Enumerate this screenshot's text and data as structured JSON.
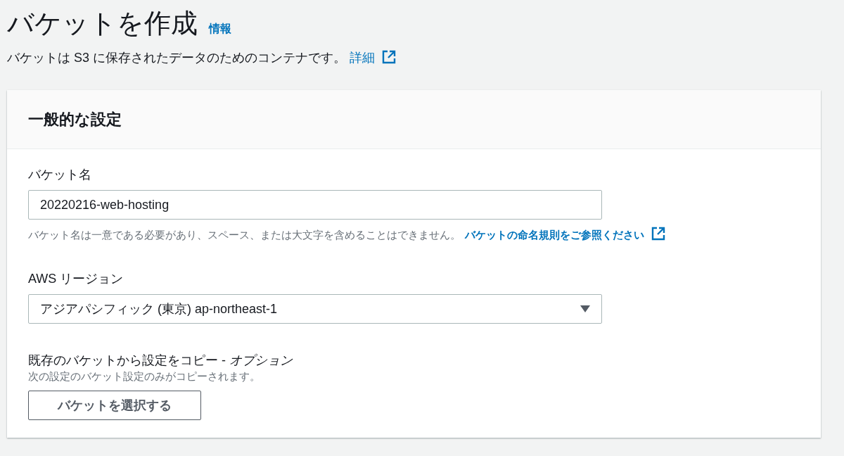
{
  "header": {
    "title": "バケットを作成",
    "info_link": "情報",
    "description": "バケットは S3 に保存されたデータのためのコンテナです。",
    "details_link": "詳細"
  },
  "general_settings": {
    "heading": "一般的な設定",
    "bucket_name": {
      "label": "バケット名",
      "value": "20220216-web-hosting",
      "hint": "バケット名は一意である必要があり、スペース、または大文字を含めることはできません。",
      "hint_link": "バケットの命名規則をご参照ください"
    },
    "region": {
      "label": "AWS リージョン",
      "value": "アジアパシフィック (東京) ap-northeast-1"
    },
    "copy_settings": {
      "label": "既存のバケットから設定をコピー - *オプション*",
      "description": "次の設定のバケット設定のみがコピーされます。",
      "button": "バケットを選択する"
    }
  }
}
